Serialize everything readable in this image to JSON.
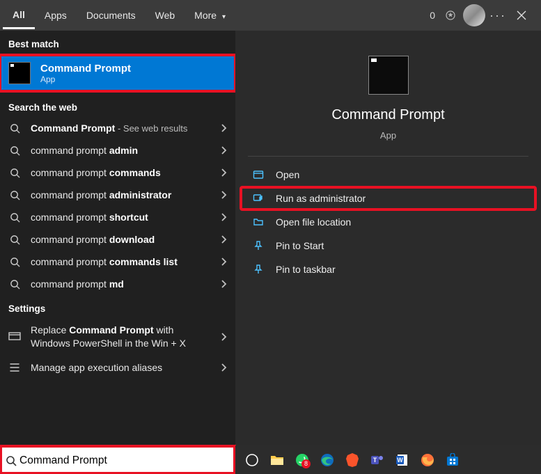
{
  "tabs": {
    "all": "All",
    "apps": "Apps",
    "documents": "Documents",
    "web": "Web",
    "more": "More"
  },
  "rewards": {
    "count": "0"
  },
  "sections": {
    "best": "Best match",
    "web": "Search the web",
    "settings": "Settings"
  },
  "best": {
    "title": "Command Prompt",
    "subtitle": "App"
  },
  "websearch": [
    {
      "pre": "",
      "bold": "Command Prompt",
      "post": "",
      "hint": " - See web results"
    },
    {
      "pre": "command prompt ",
      "bold": "admin",
      "post": "",
      "hint": ""
    },
    {
      "pre": "command prompt ",
      "bold": "commands",
      "post": "",
      "hint": ""
    },
    {
      "pre": "command prompt ",
      "bold": "administrator",
      "post": "",
      "hint": ""
    },
    {
      "pre": "command prompt ",
      "bold": "shortcut",
      "post": "",
      "hint": ""
    },
    {
      "pre": "command prompt ",
      "bold": "download",
      "post": "",
      "hint": ""
    },
    {
      "pre": "command prompt ",
      "bold": "commands list",
      "post": "",
      "hint": ""
    },
    {
      "pre": "command prompt ",
      "bold": "md",
      "post": "",
      "hint": ""
    }
  ],
  "settings": [
    {
      "pre": "Replace ",
      "bold": "Command Prompt",
      "post": " with Windows PowerShell in the Win + X"
    },
    {
      "pre": "Manage app execution aliases",
      "bold": "",
      "post": ""
    }
  ],
  "detail": {
    "title": "Command Prompt",
    "subtitle": "App"
  },
  "actions": {
    "open": "Open",
    "run_admin": "Run as administrator",
    "open_loc": "Open file location",
    "pin_start": "Pin to Start",
    "pin_taskbar": "Pin to taskbar"
  },
  "search": {
    "value": "Command Prompt"
  },
  "taskbar": {
    "whatsapp_badge": "8"
  }
}
